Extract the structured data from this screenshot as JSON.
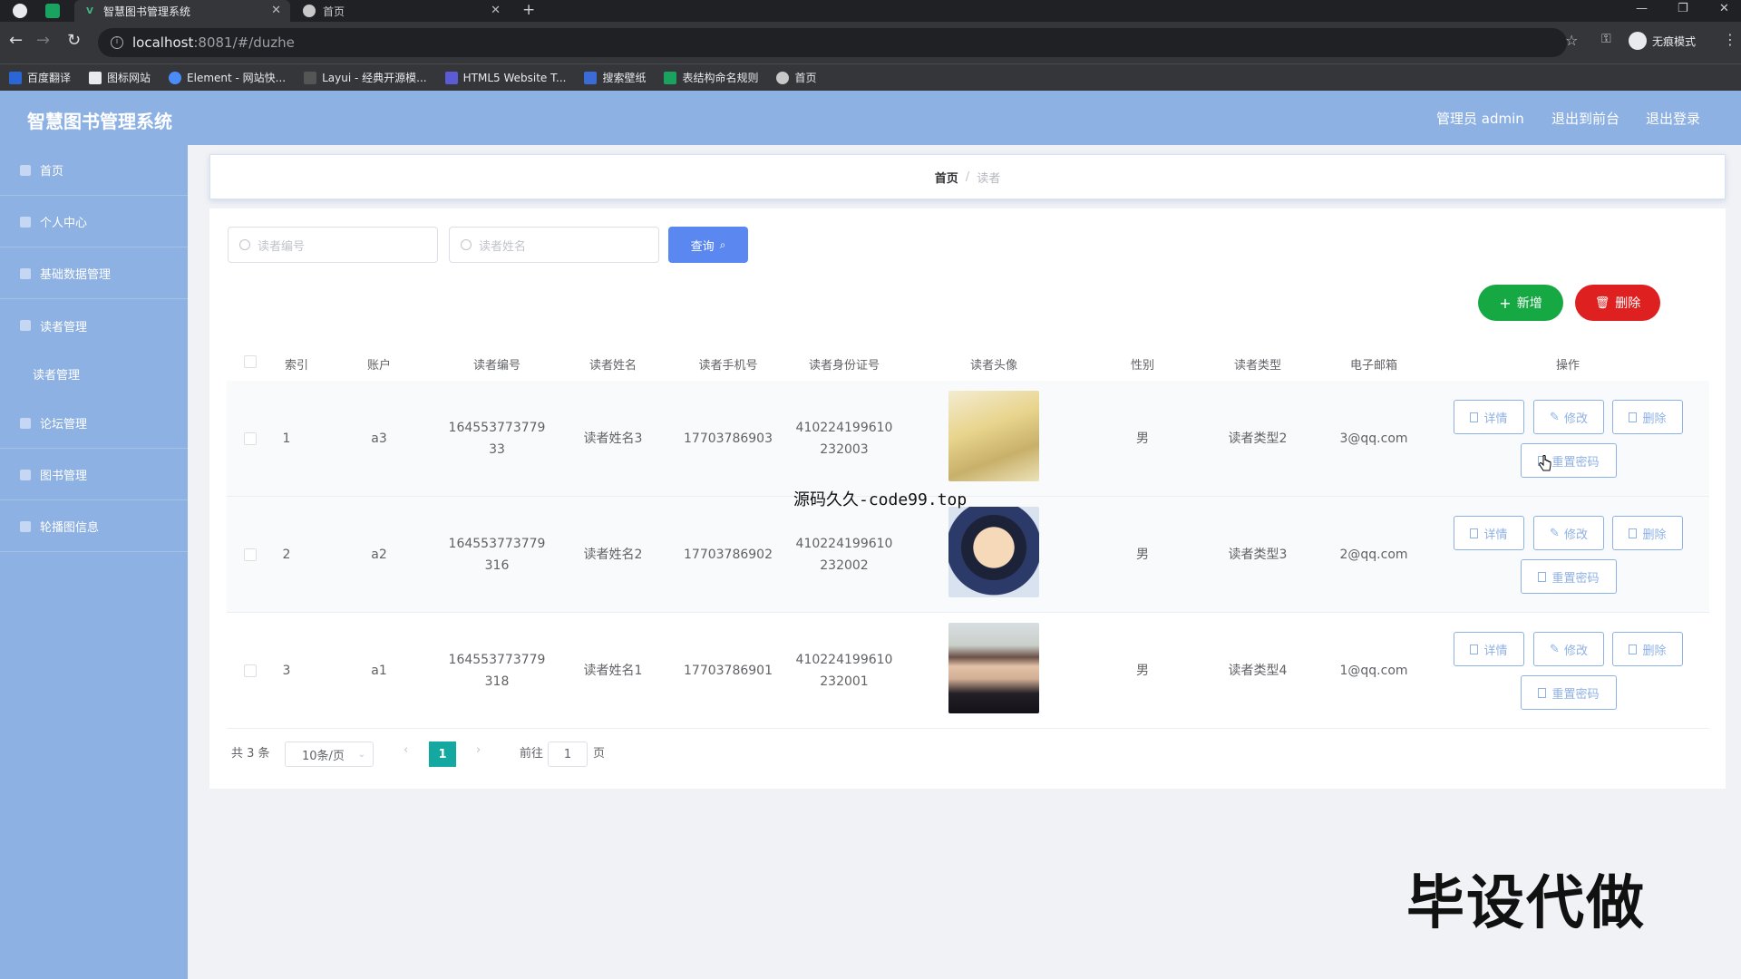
{
  "browser": {
    "tabs": [
      {
        "title": "智慧图书管理系统",
        "active": true
      },
      {
        "title": "首页",
        "active": false
      }
    ],
    "url_host": "localhost",
    "url_path": ":8081/#/duzhe",
    "profile_label": "无痕模式",
    "bookmarks": [
      "百度翻译",
      "图标网站",
      "Element - 网站快...",
      "Layui - 经典开源模...",
      "HTML5 Website T...",
      "搜索壁纸",
      "表结构命名规则",
      "首页"
    ]
  },
  "header": {
    "title": "智慧图书管理系统",
    "admin_label": "管理员 admin",
    "back_label": "退出到前台",
    "logout_label": "退出登录"
  },
  "sidebar": {
    "items": [
      {
        "label": "首页",
        "icon": "home-icon"
      },
      {
        "label": "个人中心",
        "icon": "user-icon"
      },
      {
        "label": "基础数据管理",
        "icon": "grid-icon"
      },
      {
        "label": "读者管理",
        "icon": "pin-icon"
      },
      {
        "label": "论坛管理",
        "icon": "user-icon"
      },
      {
        "label": "图书管理",
        "icon": "book-icon"
      },
      {
        "label": "轮播图信息",
        "icon": "list-icon"
      }
    ],
    "sub_item": "读者管理"
  },
  "breadcrumb": {
    "home": "首页",
    "separator": "/",
    "current": "读者"
  },
  "search": {
    "reader_no_placeholder": "读者编号",
    "reader_name_placeholder": "读者姓名",
    "query_label": "查询"
  },
  "actions": {
    "add_label": "新增",
    "delete_label": "删除"
  },
  "table": {
    "headers": [
      "索引",
      "账户",
      "读者编号",
      "读者姓名",
      "读者手机号",
      "读者身份证号",
      "读者头像",
      "性别",
      "读者类型",
      "电子邮箱",
      "操作"
    ],
    "rows": [
      {
        "index": "1",
        "account": "a3",
        "reader_no_1": "164553773779",
        "reader_no_2": "33",
        "name": "读者姓名3",
        "phone": "17703786903",
        "id_1": "410224199610",
        "id_2": "232003",
        "gender": "男",
        "type": "读者类型2",
        "email": "3@qq.com"
      },
      {
        "index": "2",
        "account": "a2",
        "reader_no_1": "164553773779",
        "reader_no_2": "316",
        "name": "读者姓名2",
        "phone": "17703786902",
        "id_1": "410224199610",
        "id_2": "232002",
        "gender": "男",
        "type": "读者类型3",
        "email": "2@qq.com"
      },
      {
        "index": "3",
        "account": "a1",
        "reader_no_1": "164553773779",
        "reader_no_2": "318",
        "name": "读者姓名1",
        "phone": "17703786901",
        "id_1": "410224199610",
        "id_2": "232001",
        "gender": "男",
        "type": "读者类型4",
        "email": "1@qq.com"
      }
    ],
    "op_labels": {
      "detail": "详情",
      "edit": "修改",
      "delete": "删除",
      "reset": "重置密码"
    }
  },
  "pagination": {
    "total_label": "共 3 条",
    "page_size": "10条/页",
    "current_page": "1",
    "goto_label": "前往",
    "goto_value": "1",
    "page_suffix": "页"
  },
  "watermarks": {
    "line1": "源码久久-code99.top",
    "line2": "毕设代做"
  },
  "colors": {
    "primary": "#8eb1e3",
    "add": "#15a843",
    "delete": "#de2020",
    "query": "#5a87f0",
    "page_active": "#15a8a0"
  }
}
